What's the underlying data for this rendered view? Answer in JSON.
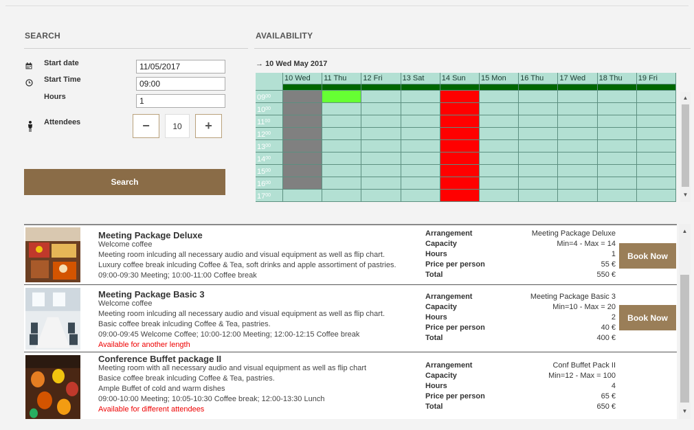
{
  "search": {
    "title": "SEARCH",
    "start_date_label": "Start date",
    "start_date_value": "11/05/2017",
    "start_time_label": "Start Time",
    "start_time_value": "09:00",
    "hours_label": "Hours",
    "hours_value": "1",
    "attendees_label": "Attendees",
    "attendees_value": "10",
    "minus_label": "−",
    "plus_label": "+",
    "button_label": "Search",
    "icons": [
      "calendar-icon",
      "clock-icon",
      "person-icon"
    ]
  },
  "availability": {
    "title": "AVAILABILITY",
    "date_header": "10 Wed May 2017",
    "days": [
      "10 Wed",
      "11 Thu",
      "12 Fri",
      "13 Sat",
      "14 Sun",
      "15 Mon",
      "16 Thu",
      "17 Wed",
      "18 Thu",
      "19 Fri"
    ],
    "hours": [
      "09",
      "10",
      "11",
      "12",
      "13",
      "14",
      "15",
      "16",
      "17"
    ],
    "hour_suffix": "00",
    "colors": {
      "free": "#b3e0d3",
      "header": "#b3e0d3",
      "day_bar": "#006600",
      "grey": "#808080",
      "selected": "#66ff33",
      "unavailable": "#ff0000",
      "time_col": "#b3e0d3"
    }
  },
  "results": [
    {
      "title": "Meeting Package Deluxe",
      "lines": [
        "Welcome coffee",
        "Meeting room inlcuding all necessary audio and visual equipment as well as flip chart.",
        "Luxury coffee break inlcuding Coffee & Tea, soft drinks and apple assortiment of pastries.",
        "09:00-09:30 Meeting; 10:00-11:00 Coffee break"
      ],
      "note": "",
      "arrangement": "Meeting Package Deluxe",
      "capacity": "Min=4 - Max = 14",
      "hours": "1",
      "price_per_person": "55 €",
      "total": "550 €",
      "book_label": "Book Now",
      "image": "coffee-break-image"
    },
    {
      "title": "Meeting Package Basic 3",
      "lines": [
        "Welcome coffee",
        "Meeting room inlcuding all necessary audio and visual equipment as well as flip chart.",
        "Basic coffee break inlcuding Coffee & Tea, pastries.",
        "09:00-09:45 Welcome Coffee; 10:00-12:00 Meeting; 12:00-12:15 Coffee break"
      ],
      "note": "Available for another length",
      "arrangement": "Meeting Package Basic 3",
      "capacity": "Min=10 - Max = 20",
      "hours": "2",
      "price_per_person": "40 €",
      "total": "400 €",
      "book_label": "Book Now",
      "image": "meeting-room-image"
    },
    {
      "title": "Conference Buffet package II",
      "lines": [
        "Meeting room with all necessary audio and visual equipment as well as flip chart",
        "Basice coffee break inlcuding Coffee & Tea, pastries.",
        "Ample Buffet of cold and warm dishes",
        "09:00-10:00 Meeting; 10:05-10:30 Coffee break; 12:00-13:30 Lunch"
      ],
      "note": "Available for different attendees",
      "arrangement": "Conf Buffet Pack II",
      "capacity": "Min=12 - Max = 100",
      "hours": "4",
      "price_per_person": "65 €",
      "total": "650 €",
      "book_label": "",
      "image": "buffet-image"
    }
  ],
  "result_labels": {
    "arrangement": "Arrangement",
    "capacity": "Capacity",
    "hours": "Hours",
    "price_per_person": "Price per person",
    "total": "Total"
  }
}
